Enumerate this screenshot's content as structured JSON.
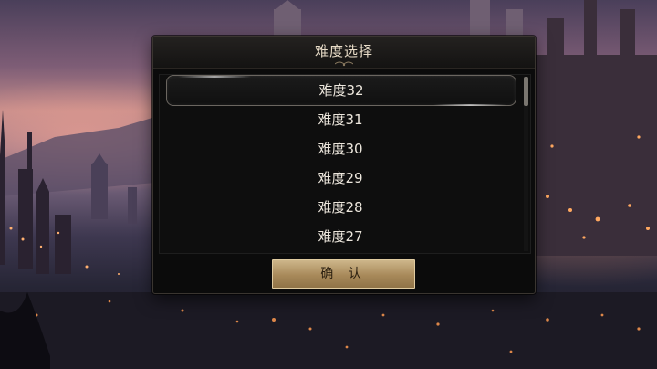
{
  "dialog": {
    "title": "难度选择",
    "items": [
      {
        "label": "难度32",
        "selected": true
      },
      {
        "label": "难度31",
        "selected": false
      },
      {
        "label": "难度30",
        "selected": false
      },
      {
        "label": "难度29",
        "selected": false
      },
      {
        "label": "难度28",
        "selected": false
      },
      {
        "label": "难度27",
        "selected": false
      }
    ],
    "confirm_label": "确 认"
  },
  "colors": {
    "accent_gold": "#b89a68",
    "text": "#ece6dc",
    "panel_bg": "#0b0b0b"
  }
}
